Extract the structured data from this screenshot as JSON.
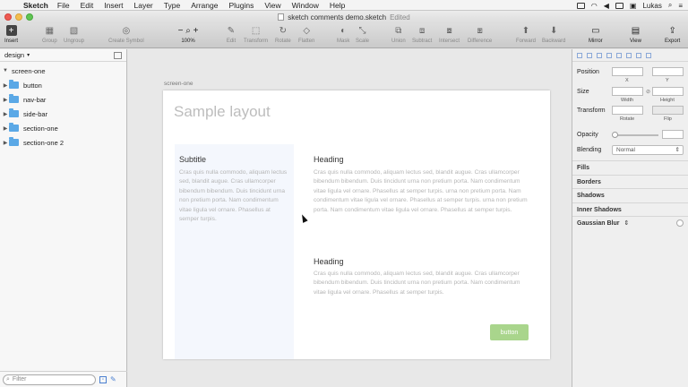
{
  "menubar": {
    "app": "Sketch",
    "menus": [
      "File",
      "Edit",
      "Insert",
      "Layer",
      "Type",
      "Arrange",
      "Plugins",
      "View",
      "Window",
      "Help"
    ],
    "user": "Lukas"
  },
  "window": {
    "title": "sketch comments demo.sketch",
    "status": "Edited"
  },
  "toolbar": {
    "insert": "Insert",
    "group": "Group",
    "ungroup": "Ungroup",
    "create_symbol": "Create Symbol",
    "zoom": "100%",
    "edit": "Edit",
    "transform": "Transform",
    "rotate": "Rotate",
    "flatten": "Flatten",
    "mask": "Mask",
    "scale": "Scale",
    "union": "Union",
    "subtract": "Subtract",
    "intersect": "Intersect",
    "difference": "Difference",
    "forward": "Forward",
    "backward": "Backward",
    "mirror": "Mirror",
    "view": "View",
    "export": "Export"
  },
  "layers": {
    "page": "design",
    "artboard": "screen-one",
    "items": [
      "button",
      "nav-bar",
      "side-bar",
      "section-one",
      "section-one 2"
    ],
    "filter_placeholder": "Filter"
  },
  "canvas": {
    "artboard_label": "screen-one",
    "title": "Sample layout",
    "sidebar": {
      "subtitle": "Subtitle",
      "text": "Cras quis nulla commodo, aliquam lectus sed, blandit augue. Cras ullamcorper bibendum bibendum. Duis tincidunt urna non pretium porta. Nam condimentum vitae ligula vel ornare. Phasellus at semper turpis."
    },
    "section1": {
      "heading": "Heading",
      "text": "Cras quis nulla commodo, aliquam lectus sed, blandit augue. Cras ullamcorper bibendum bibendum. Duis tincidunt urna non pretium porta. Nam condimentum vitae ligula vel ornare. Phasellus at semper turpis. urna non pretium porta. Nam condimentum vitae ligula vel ornare. Phasellus at semper turpis. urna non pretium porta. Nam condimentum vitae ligula vel ornare. Phasellus at semper turpis."
    },
    "section2": {
      "heading": "Heading",
      "text": "Cras quis nulla commodo, aliquam lectus sed, blandit augue. Cras ullamcorper bibendum bibendum. Duis tincidunt urna non pretium porta. Nam condimentum vitae ligula vel ornare. Phasellus at semper turpis."
    },
    "button_label": "button",
    "button_color": "#a9d58c"
  },
  "inspector": {
    "position": "Position",
    "x": "X",
    "y": "Y",
    "size": "Size",
    "width": "Width",
    "height": "Height",
    "transform": "Transform",
    "rotate": "Rotate",
    "flip": "Flip",
    "opacity": "Opacity",
    "blending": "Blending",
    "blending_value": "Normal",
    "fills": "Fills",
    "borders": "Borders",
    "shadows": "Shadows",
    "inner_shadows": "Inner Shadows",
    "gaussian_blur": "Gaussian Blur"
  }
}
